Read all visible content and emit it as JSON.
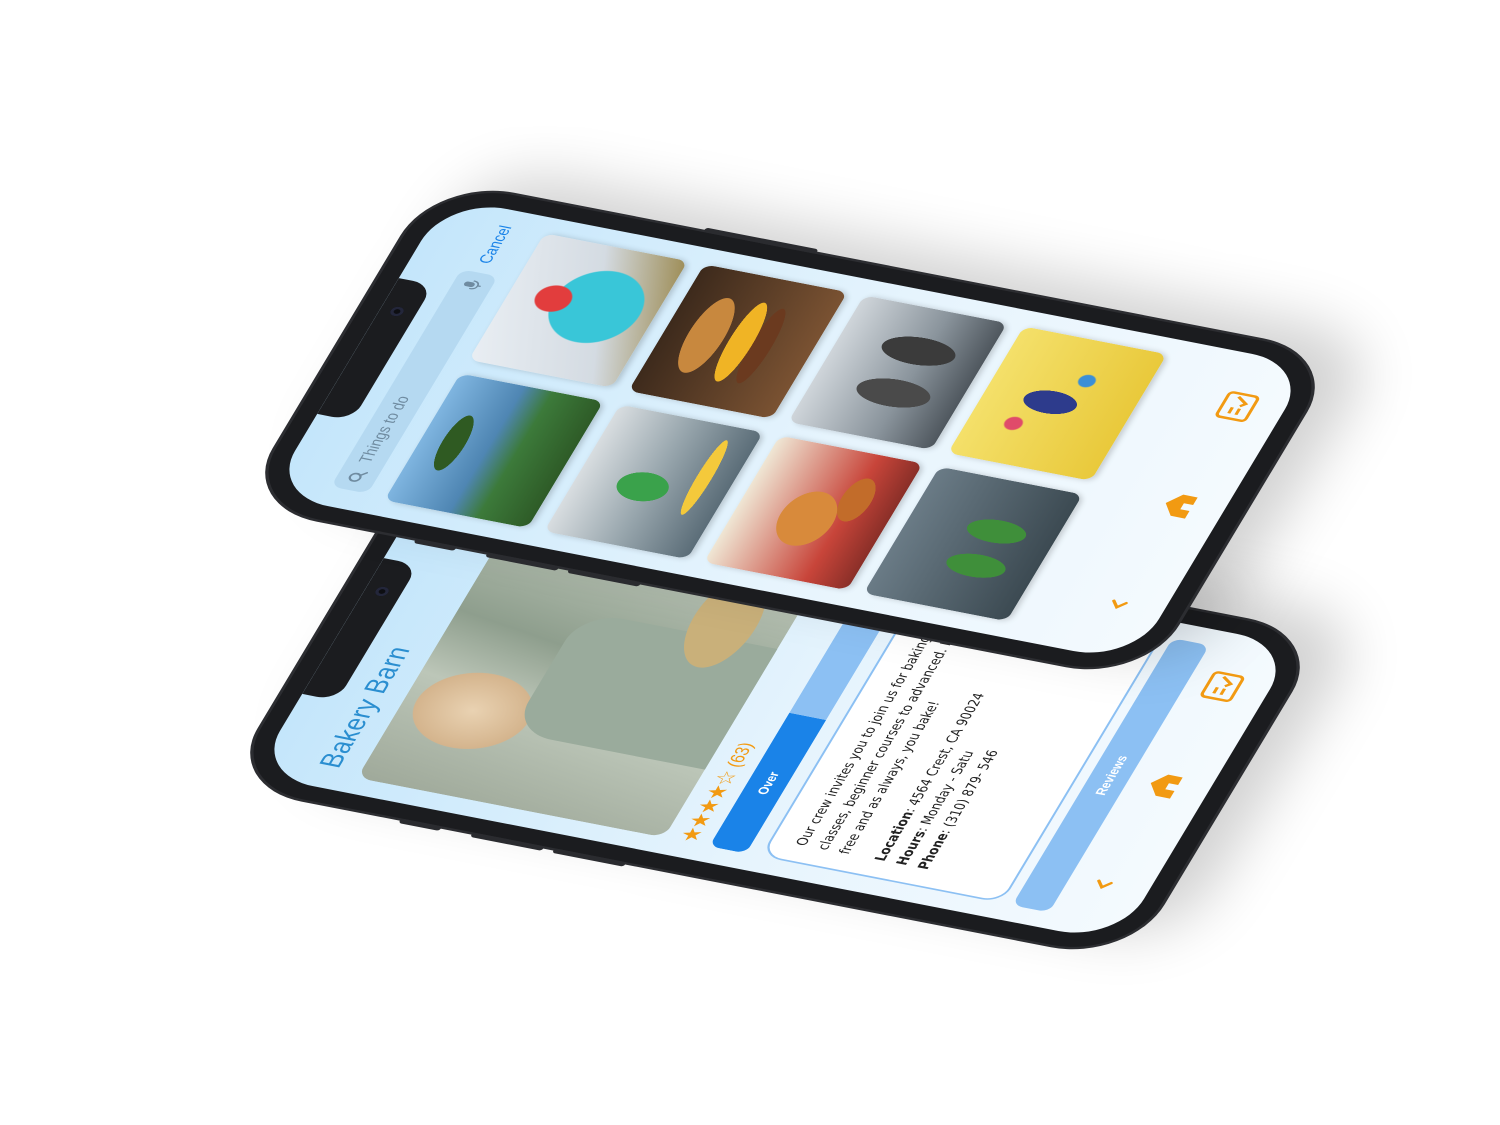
{
  "back_phone": {
    "title": "Bakery Barn",
    "rating_stars": "★★★★☆",
    "rating_count": "(63)",
    "tabs": [
      {
        "label": "Over"
      },
      {
        "label": ""
      }
    ],
    "description": "Our crew invites you to join us for baking classes, beginner courses to advanced. It is free and as always, you bake!",
    "location_label": "Location",
    "location_value": ": 4564 Crest, CA 90024",
    "hours_label": "Hours",
    "hours_value": ": Monday - Satu",
    "phone_label": "Phone",
    "phone_value": ": (310) 879- 546",
    "reviews_label": "Reviews",
    "icons": {
      "back": "chevron-left-icon",
      "home": "home-icon",
      "checklist": "checklist-icon"
    },
    "accent": "#f29a12"
  },
  "front_phone": {
    "search": {
      "placeholder": "Things to do",
      "value": ""
    },
    "cancel_label": "Cancel",
    "tiles": [
      {
        "name": "drink-tile",
        "subject": "tropical drink"
      },
      {
        "name": "palm-tile",
        "subject": "palm tree coast"
      },
      {
        "name": "burger-tile",
        "subject": "burger"
      },
      {
        "name": "surf-tile",
        "subject": "kids surfing"
      },
      {
        "name": "tiki-tile",
        "subject": "tiki statues"
      },
      {
        "name": "fish-tile",
        "subject": "fish and chips"
      },
      {
        "name": "climb-tile",
        "subject": "climbing wall"
      },
      {
        "name": "hula-tile",
        "subject": "hula dancers"
      }
    ],
    "icons": {
      "back": "chevron-left-icon",
      "home": "home-icon",
      "checklist": "checklist-icon"
    },
    "colors": {
      "accent": "#f29a12",
      "link": "#1a83e8"
    }
  }
}
